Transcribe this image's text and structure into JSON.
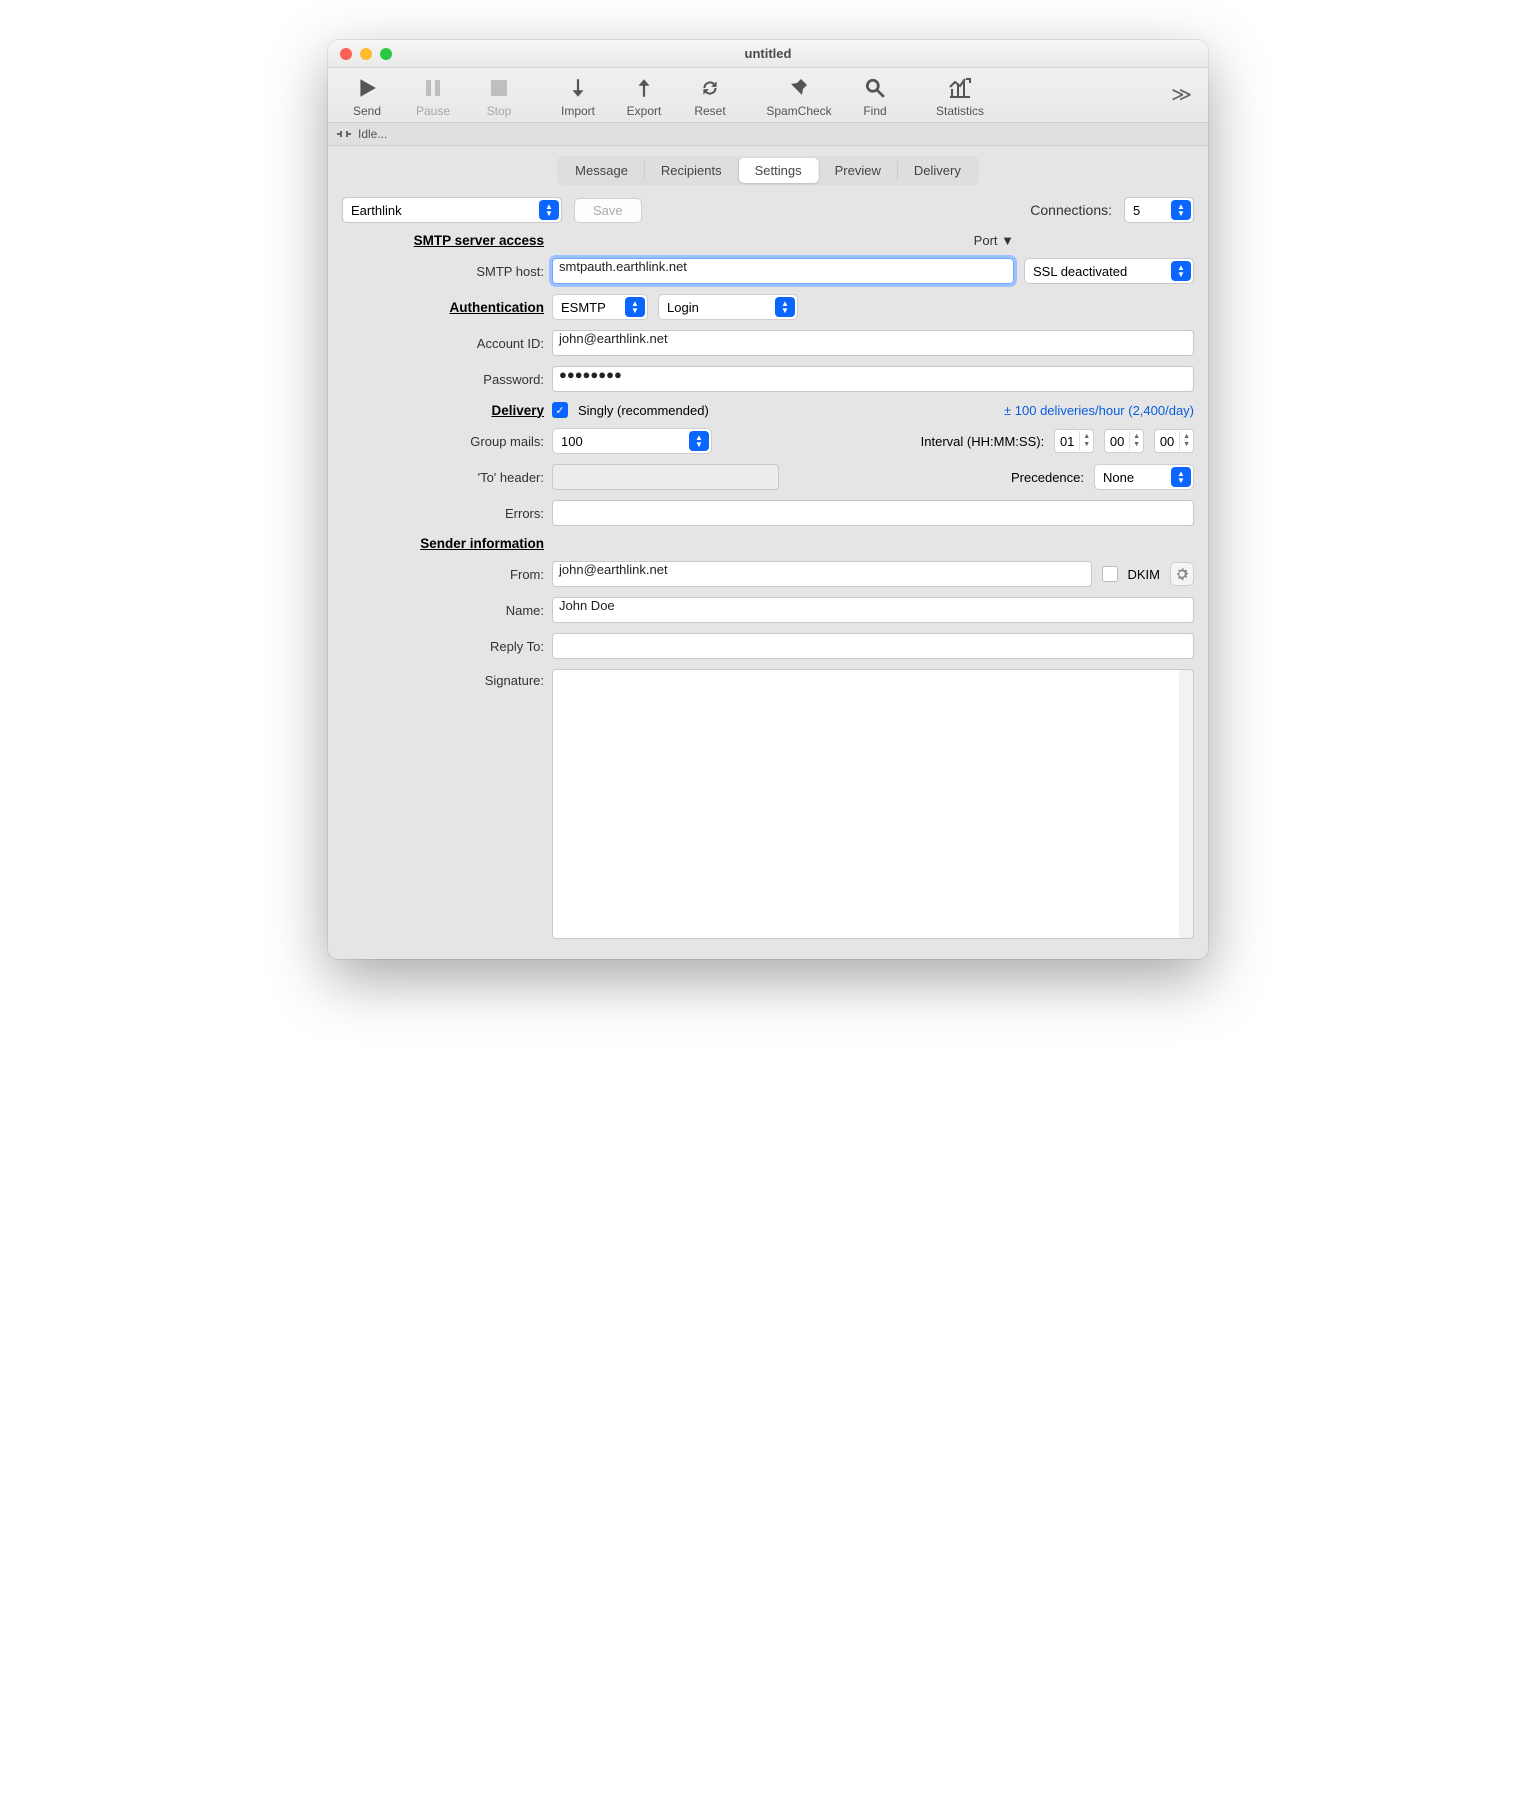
{
  "window": {
    "title": "untitled"
  },
  "toolbar": {
    "send": "Send",
    "pause": "Pause",
    "stop": "Stop",
    "import": "Import",
    "export": "Export",
    "reset": "Reset",
    "spamcheck": "SpamCheck",
    "find": "Find",
    "statistics": "Statistics"
  },
  "status": {
    "text": "Idle..."
  },
  "tabs": {
    "message": "Message",
    "recipients": "Recipients",
    "settings": "Settings",
    "preview": "Preview",
    "delivery": "Delivery"
  },
  "top": {
    "profile": "Earthlink",
    "save": "Save",
    "connections_label": "Connections:",
    "connections_value": "5"
  },
  "sections": {
    "smtp": "SMTP server access",
    "auth": "Authentication",
    "delivery": "Delivery",
    "sender": "Sender information"
  },
  "labels": {
    "smtp_host": "SMTP host:",
    "port": "Port ▼",
    "ssl": "SSL deactivated",
    "auth_type": "ESMTP",
    "auth_method": "Login",
    "account_id": "Account ID:",
    "password": "Password:",
    "singly": "Singly (recommended)",
    "rate": "± 100 deliveries/hour (2,400/day)",
    "group_mails": "Group mails:",
    "interval": "Interval (HH:MM:SS):",
    "to_header": "'To' header:",
    "precedence": "Precedence:",
    "precedence_val": "None",
    "errors": "Errors:",
    "from": "From:",
    "dkim": "DKIM",
    "name": "Name:",
    "reply_to": "Reply To:",
    "signature": "Signature:"
  },
  "values": {
    "smtp_host": "smtpauth.earthlink.net",
    "account_id": "john@earthlink.net",
    "password": "●●●●●●●●",
    "group_mails": "100",
    "hh": "01",
    "mm": "00",
    "ss": "00",
    "to_header": "",
    "errors": "",
    "from": "john@earthlink.net",
    "name": "John Doe",
    "reply_to": "",
    "signature": ""
  }
}
